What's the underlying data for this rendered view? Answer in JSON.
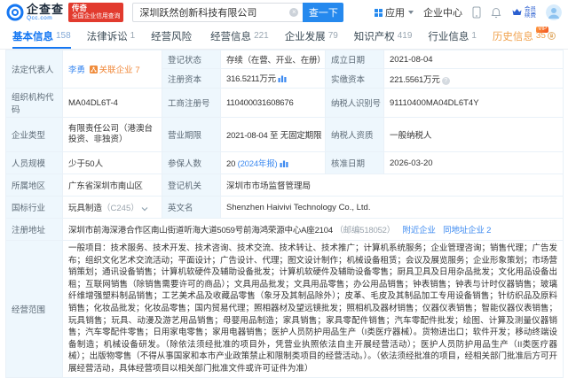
{
  "colors": {
    "brand_blue": "#1577f2",
    "button_blue": "#2589ee",
    "link_blue": "#3d8af0",
    "accent_orange": "#f0883a",
    "vip_orange": "#f0a14c",
    "badge_red": "#e23a2e",
    "label_bg": "#eef7fd"
  },
  "icons": {
    "clear_glyph": "×",
    "info_glyph": "?"
  },
  "brand": {
    "logo_cn": "企查查",
    "logo_en": "Qcc.com",
    "badge_line1": "传奇",
    "badge_line2": "全国企业信用查询"
  },
  "header": {
    "search_value": "深圳跃然创新科技有限公司",
    "search_button": "查一下",
    "nav_app": "应用",
    "nav_center": "企业中心",
    "vip_line1": "会员",
    "vip_line2": "续费"
  },
  "tabs_meta": {
    "vip_badge": "VIP"
  },
  "tabs": [
    {
      "label": "基本信息",
      "count": "158"
    },
    {
      "label": "法律诉讼",
      "count": "1"
    },
    {
      "label": "经营风险",
      "count": ""
    },
    {
      "label": "经营信息",
      "count": "221"
    },
    {
      "label": "企业发展",
      "count": "79"
    },
    {
      "label": "知识产权",
      "count": "419"
    },
    {
      "label": "行业信息",
      "count": "1"
    },
    {
      "label": "历史信息",
      "count": "35"
    }
  ],
  "info": {
    "legal_rep_label": "法定代表人",
    "legal_rep_name": "李勇",
    "related_label": "关联企业",
    "related_count": "7",
    "reg_status_label": "登记状态",
    "reg_status": "存续（在营、开业、在册）",
    "establish_label": "成立日期",
    "establish_date": "2021-08-04",
    "reg_capital_label": "注册资本",
    "reg_capital": "316.5211万元",
    "paid_capital_label": "实缴资本",
    "paid_capital": "221.5561万元",
    "org_code_label": "组织机构代码",
    "org_code": "MA04DL6T-4",
    "biz_reg_no_label": "工商注册号",
    "biz_reg_no": "110400031608676",
    "tax_id_label": "纳税人识别号",
    "tax_id": "91110400MA04DL6T4Y",
    "company_type_label": "企业类型",
    "company_type": "有限责任公司（港澳台投资、非独资）",
    "biz_term_label": "营业期限",
    "biz_term": "2021-08-04 至 无固定期限",
    "taxpayer_quality_label": "纳税人资质",
    "taxpayer_quality": "一般纳税人",
    "staff_size_label": "人员规模",
    "staff_size": "少于50人",
    "insured_label": "参保人数",
    "insured_count": "20",
    "insured_report": "(2024年报)",
    "approval_label": "核准日期",
    "approval_date": "2026-03-20",
    "region_label": "所属地区",
    "region": "广东省深圳市南山区",
    "reg_authority_label": "登记机关",
    "reg_authority": "深圳市市场监督管理局",
    "industry_label": "国标行业",
    "industry": "玩具制造",
    "industry_code": "（C245）",
    "en_name_label": "英文名",
    "en_name": "Shenzhen Haivivi Technology Co., Ltd.",
    "address_label": "注册地址",
    "address": "深圳市前海深港合作区南山街道听海大道5059号前海鸿荣源中心A座2104",
    "address_zip": "（邮编518052）",
    "nearby_link": "附近企业",
    "same_address_link": "同地址企业",
    "same_address_count": "2",
    "scope_label": "经营范围",
    "scope_text": "一般项目：技术服务、技术开发、技术咨询、技术交流、技术转让、技术推广；计算机系统服务；企业管理咨询；销售代理；广告发布；组织文化艺术交流活动；平面设计；广告设计、代理；图文设计制作；机械设备租赁；会议及展览服务；企业形象策划；市场营销策划；通讯设备销售；计算机软硬件及辅助设备批发；计算机软硬件及辅助设备零售；厨具卫具及日用杂品批发；文化用品设备出租；互联网销售（除销售需要许可的商品）；文具用品批发；文具用品零售；办公用品销售；钟表销售；钟表与计时仪器销售；玻璃纤维增强塑料制品销售；工艺美术品及收藏品零售（象牙及其制品除外）；皮革、毛皮及其制品加工专用设备销售；针纺织品及原料销售；化妆品批发；化妆品零售；国内贸易代理；照相器材及望远镜批发；照相机及器材销售；仪器仪表销售；智能仪器仪表销售；玩具销售；玩具、动漫及游艺用品销售；母婴用品制造；家具销售；家具零配件销售；汽车零配件批发；绘图、计算及测量仪器销售；汽车零配件零售；日用家电零售；家用电器销售；医护人员防护用品生产（I类医疗器械）。货物进出口；软件开发；移动终端设备制造；机械设备研发。（除依法须经批准的项目外，凭营业执照依法自主开展经营活动）；医护人员防护用品生产（II类医疗器械）；出版物零售（不得从事国家和本市产业政策禁止和限制类项目的经营活动。）。（依法须经批准的项目，经相关部门批准后方可开展经营活动，具体经营项目以相关部门批准文件或许可证件为准）"
  }
}
